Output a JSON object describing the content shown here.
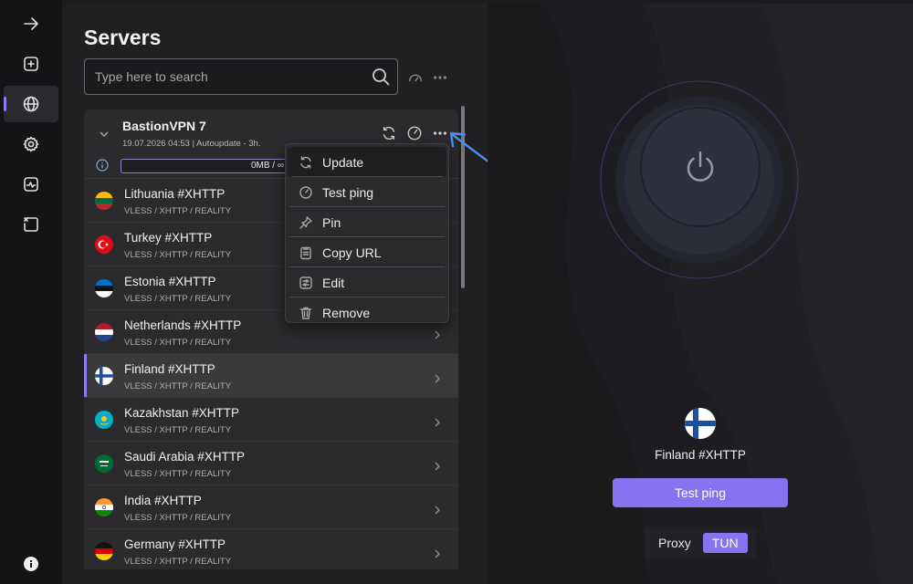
{
  "sidebar": {
    "items": [
      {
        "icon": "arrow-right-icon"
      },
      {
        "icon": "add-profile-icon"
      },
      {
        "icon": "globe-icon",
        "active": true
      },
      {
        "icon": "gear-icon"
      },
      {
        "icon": "activity-chart-icon"
      },
      {
        "icon": "logs-icon"
      }
    ],
    "bottom_icon": "info-icon"
  },
  "servers": {
    "title": "Servers",
    "search": {
      "placeholder": "Type here to search",
      "value": ""
    },
    "group": {
      "name": "BastionVPN 7",
      "subtitle": "19.07.2026 04:53 | Autoupdate - 3h.",
      "traffic": "0MB / ∞"
    },
    "items": [
      {
        "name": "Lithuania #XHTTP",
        "protocol": "VLESS / XHTTP / REALITY",
        "flag": "lt"
      },
      {
        "name": "Turkey #XHTTP",
        "protocol": "VLESS / XHTTP / REALITY",
        "flag": "tr"
      },
      {
        "name": "Estonia #XHTTP",
        "protocol": "VLESS / XHTTP / REALITY",
        "flag": "ee"
      },
      {
        "name": "Netherlands #XHTTP",
        "protocol": "VLESS / XHTTP / REALITY",
        "flag": "nl"
      },
      {
        "name": "Finland #XHTTP",
        "protocol": "VLESS / XHTTP / REALITY",
        "flag": "fi",
        "selected": true
      },
      {
        "name": "Kazakhstan #XHTTP",
        "protocol": "VLESS / XHTTP / REALITY",
        "flag": "kz"
      },
      {
        "name": "Saudi Arabia #XHTTP",
        "protocol": "VLESS / XHTTP / REALITY",
        "flag": "sa"
      },
      {
        "name": "India #XHTTP",
        "protocol": "VLESS / XHTTP / REALITY",
        "flag": "in"
      },
      {
        "name": "Germany #XHTTP",
        "protocol": "VLESS / XHTTP / REALITY",
        "flag": "de"
      }
    ]
  },
  "context_menu": {
    "items": [
      {
        "label": "Update",
        "icon": "refresh-icon"
      },
      {
        "label": "Test ping",
        "icon": "speedometer-icon"
      },
      {
        "label": "Pin",
        "icon": "pin-icon"
      },
      {
        "label": "Copy URL",
        "icon": "clipboard-icon"
      },
      {
        "label": "Edit",
        "icon": "edit-settings-icon"
      },
      {
        "label": "Remove",
        "icon": "trash-icon"
      }
    ]
  },
  "connection": {
    "current_server": "Finland #XHTTP",
    "test_ping_label": "Test ping",
    "mode": {
      "proxy": "Proxy",
      "tun": "TUN",
      "active": "TUN"
    }
  },
  "colors": {
    "accent": "#8673f0",
    "annotation": "#4a8ef0"
  }
}
